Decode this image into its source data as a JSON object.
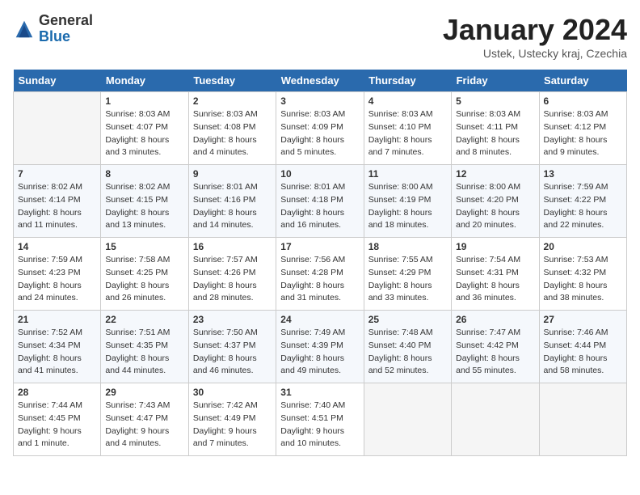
{
  "header": {
    "logo_general": "General",
    "logo_blue": "Blue",
    "month_title": "January 2024",
    "location": "Ustek, Ustecky kraj, Czechia"
  },
  "days_of_week": [
    "Sunday",
    "Monday",
    "Tuesday",
    "Wednesday",
    "Thursday",
    "Friday",
    "Saturday"
  ],
  "weeks": [
    [
      {
        "num": "",
        "empty": true
      },
      {
        "num": "1",
        "sunrise": "8:03 AM",
        "sunset": "4:07 PM",
        "daylight": "8 hours and 3 minutes."
      },
      {
        "num": "2",
        "sunrise": "8:03 AM",
        "sunset": "4:08 PM",
        "daylight": "8 hours and 4 minutes."
      },
      {
        "num": "3",
        "sunrise": "8:03 AM",
        "sunset": "4:09 PM",
        "daylight": "8 hours and 5 minutes."
      },
      {
        "num": "4",
        "sunrise": "8:03 AM",
        "sunset": "4:10 PM",
        "daylight": "8 hours and 7 minutes."
      },
      {
        "num": "5",
        "sunrise": "8:03 AM",
        "sunset": "4:11 PM",
        "daylight": "8 hours and 8 minutes."
      },
      {
        "num": "6",
        "sunrise": "8:03 AM",
        "sunset": "4:12 PM",
        "daylight": "8 hours and 9 minutes."
      }
    ],
    [
      {
        "num": "7",
        "sunrise": "8:02 AM",
        "sunset": "4:14 PM",
        "daylight": "8 hours and 11 minutes."
      },
      {
        "num": "8",
        "sunrise": "8:02 AM",
        "sunset": "4:15 PM",
        "daylight": "8 hours and 13 minutes."
      },
      {
        "num": "9",
        "sunrise": "8:01 AM",
        "sunset": "4:16 PM",
        "daylight": "8 hours and 14 minutes."
      },
      {
        "num": "10",
        "sunrise": "8:01 AM",
        "sunset": "4:18 PM",
        "daylight": "8 hours and 16 minutes."
      },
      {
        "num": "11",
        "sunrise": "8:00 AM",
        "sunset": "4:19 PM",
        "daylight": "8 hours and 18 minutes."
      },
      {
        "num": "12",
        "sunrise": "8:00 AM",
        "sunset": "4:20 PM",
        "daylight": "8 hours and 20 minutes."
      },
      {
        "num": "13",
        "sunrise": "7:59 AM",
        "sunset": "4:22 PM",
        "daylight": "8 hours and 22 minutes."
      }
    ],
    [
      {
        "num": "14",
        "sunrise": "7:59 AM",
        "sunset": "4:23 PM",
        "daylight": "8 hours and 24 minutes."
      },
      {
        "num": "15",
        "sunrise": "7:58 AM",
        "sunset": "4:25 PM",
        "daylight": "8 hours and 26 minutes."
      },
      {
        "num": "16",
        "sunrise": "7:57 AM",
        "sunset": "4:26 PM",
        "daylight": "8 hours and 28 minutes."
      },
      {
        "num": "17",
        "sunrise": "7:56 AM",
        "sunset": "4:28 PM",
        "daylight": "8 hours and 31 minutes."
      },
      {
        "num": "18",
        "sunrise": "7:55 AM",
        "sunset": "4:29 PM",
        "daylight": "8 hours and 33 minutes."
      },
      {
        "num": "19",
        "sunrise": "7:54 AM",
        "sunset": "4:31 PM",
        "daylight": "8 hours and 36 minutes."
      },
      {
        "num": "20",
        "sunrise": "7:53 AM",
        "sunset": "4:32 PM",
        "daylight": "8 hours and 38 minutes."
      }
    ],
    [
      {
        "num": "21",
        "sunrise": "7:52 AM",
        "sunset": "4:34 PM",
        "daylight": "8 hours and 41 minutes."
      },
      {
        "num": "22",
        "sunrise": "7:51 AM",
        "sunset": "4:35 PM",
        "daylight": "8 hours and 44 minutes."
      },
      {
        "num": "23",
        "sunrise": "7:50 AM",
        "sunset": "4:37 PM",
        "daylight": "8 hours and 46 minutes."
      },
      {
        "num": "24",
        "sunrise": "7:49 AM",
        "sunset": "4:39 PM",
        "daylight": "8 hours and 49 minutes."
      },
      {
        "num": "25",
        "sunrise": "7:48 AM",
        "sunset": "4:40 PM",
        "daylight": "8 hours and 52 minutes."
      },
      {
        "num": "26",
        "sunrise": "7:47 AM",
        "sunset": "4:42 PM",
        "daylight": "8 hours and 55 minutes."
      },
      {
        "num": "27",
        "sunrise": "7:46 AM",
        "sunset": "4:44 PM",
        "daylight": "8 hours and 58 minutes."
      }
    ],
    [
      {
        "num": "28",
        "sunrise": "7:44 AM",
        "sunset": "4:45 PM",
        "daylight": "9 hours and 1 minute."
      },
      {
        "num": "29",
        "sunrise": "7:43 AM",
        "sunset": "4:47 PM",
        "daylight": "9 hours and 4 minutes."
      },
      {
        "num": "30",
        "sunrise": "7:42 AM",
        "sunset": "4:49 PM",
        "daylight": "9 hours and 7 minutes."
      },
      {
        "num": "31",
        "sunrise": "7:40 AM",
        "sunset": "4:51 PM",
        "daylight": "9 hours and 10 minutes."
      },
      {
        "num": "",
        "empty": true
      },
      {
        "num": "",
        "empty": true
      },
      {
        "num": "",
        "empty": true
      }
    ]
  ],
  "labels": {
    "sunrise": "Sunrise:",
    "sunset": "Sunset:",
    "daylight": "Daylight:"
  }
}
